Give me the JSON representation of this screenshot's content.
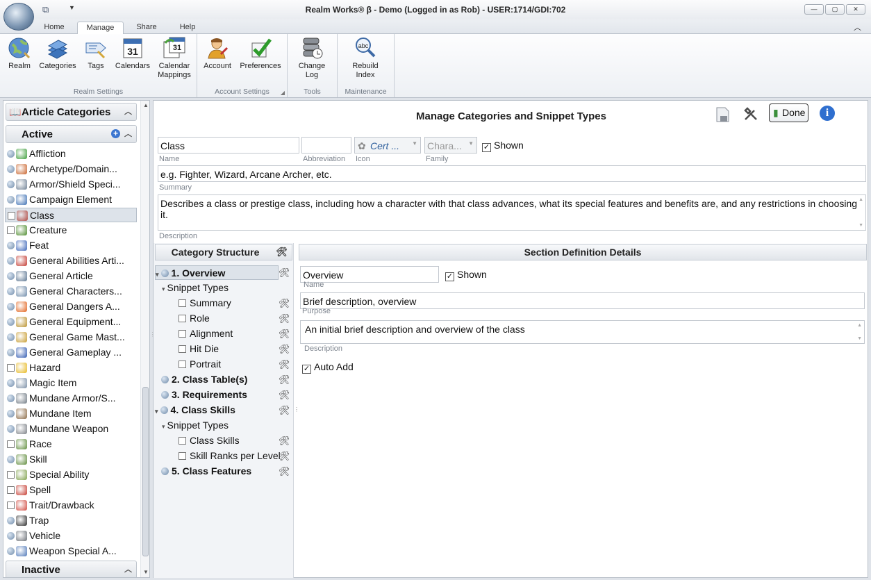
{
  "window": {
    "title": "Realm Works® β - Demo (Logged in as Rob) - USER:1714/GDI:702"
  },
  "tabs": [
    "Home",
    "Manage",
    "Share",
    "Help"
  ],
  "ribbon": {
    "realm_settings": {
      "label": "Realm Settings",
      "buttons": [
        "Realm",
        "Categories",
        "Tags",
        "Calendars",
        "Calendar Mappings"
      ]
    },
    "account_settings": {
      "label": "Account Settings",
      "buttons": [
        "Account",
        "Preferences"
      ]
    },
    "tools": {
      "label": "Tools",
      "buttons": [
        "Change Log"
      ]
    },
    "maintenance": {
      "label": "Maintenance",
      "buttons": [
        "Rebuild Index"
      ]
    }
  },
  "sidebar": {
    "title": "Article Categories",
    "active_label": "Active",
    "inactive_label": "Inactive",
    "items": [
      {
        "label": "Affliction",
        "status": "globe",
        "color": "#3a9b37"
      },
      {
        "label": "Archetype/Domain...",
        "status": "globe",
        "color": "#c8622a"
      },
      {
        "label": "Armor/Shield Speci...",
        "status": "globe",
        "color": "#6d7f93"
      },
      {
        "label": "Campaign Element",
        "status": "globe",
        "color": "#3c6fb3"
      },
      {
        "label": "Class",
        "status": "dice",
        "color": "#b0463f"
      },
      {
        "label": "Creature",
        "status": "dice",
        "color": "#4d8b2c"
      },
      {
        "label": "Feat",
        "status": "globe",
        "color": "#3a64b8"
      },
      {
        "label": "General Abilities Arti...",
        "status": "globe",
        "color": "#c2372e"
      },
      {
        "label": "General Article",
        "status": "globe",
        "color": "#5a7490"
      },
      {
        "label": "General Characters...",
        "status": "globe",
        "color": "#6d8aa9"
      },
      {
        "label": "General Dangers A...",
        "status": "globe",
        "color": "#e2631d"
      },
      {
        "label": "General Equipment...",
        "status": "globe",
        "color": "#b8902b"
      },
      {
        "label": "General Game Mast...",
        "status": "globe",
        "color": "#c79b2e"
      },
      {
        "label": "General Gameplay ...",
        "status": "globe",
        "color": "#2f59b0"
      },
      {
        "label": "Hazard",
        "status": "dice",
        "color": "#e6b820"
      },
      {
        "label": "Magic Item",
        "status": "globe",
        "color": "#7a8ea5"
      },
      {
        "label": "Mundane Armor/S...",
        "status": "globe",
        "color": "#707a84"
      },
      {
        "label": "Mundane Item",
        "status": "globe",
        "color": "#8b6a45"
      },
      {
        "label": "Mundane Weapon",
        "status": "globe",
        "color": "#7b7f85"
      },
      {
        "label": "Race",
        "status": "dice",
        "color": "#5e8c3a"
      },
      {
        "label": "Skill",
        "status": "globe",
        "color": "#5f8b3b"
      },
      {
        "label": "Special Ability",
        "status": "dice",
        "color": "#7ea04a"
      },
      {
        "label": "Spell",
        "status": "dice",
        "color": "#c53a2f"
      },
      {
        "label": "Trait/Drawback",
        "status": "dice",
        "color": "#d0473d"
      },
      {
        "label": "Trap",
        "status": "globe",
        "color": "#2b2b2b"
      },
      {
        "label": "Vehicle",
        "status": "globe",
        "color": "#6a6f76"
      },
      {
        "label": "Weapon Special A...",
        "status": "globe",
        "color": "#4f78b8"
      }
    ]
  },
  "main": {
    "title": "Manage Categories and Snippet Types",
    "done_label": "Done",
    "name_value": "Class",
    "name_label": "Name",
    "abbreviation_value": "",
    "abbreviation_label": "Abbreviation",
    "icon_value": "Cert ...",
    "icon_label": "Icon",
    "family_value": "Chara...",
    "family_label": "Family",
    "shown_label": "Shown",
    "summary_value": "e.g. Fighter, Wizard, Arcane Archer, etc.",
    "summary_label": "Summary",
    "description_value": "Describes a class or prestige class, including how a character with that class advances, what its special features and benefits are, and any restrictions in choosing it.",
    "description_label": "Description"
  },
  "structure": {
    "title": "Category Structure",
    "rows": [
      {
        "label": "1. Overview",
        "kind": "section"
      },
      {
        "label": "Snippet Types",
        "kind": "group"
      },
      {
        "label": "Summary",
        "kind": "snippet"
      },
      {
        "label": "Role",
        "kind": "snippet"
      },
      {
        "label": "Alignment",
        "kind": "snippet"
      },
      {
        "label": "Hit Die",
        "kind": "snippet"
      },
      {
        "label": "Portrait",
        "kind": "snippet"
      },
      {
        "label": "2. Class Table(s)",
        "kind": "section"
      },
      {
        "label": "3. Requirements",
        "kind": "section"
      },
      {
        "label": "4. Class Skills",
        "kind": "section"
      },
      {
        "label": "Snippet Types",
        "kind": "group"
      },
      {
        "label": "Class Skills",
        "kind": "snippet"
      },
      {
        "label": "Skill Ranks per Level",
        "kind": "snippet"
      },
      {
        "label": "5. Class Features",
        "kind": "section"
      }
    ]
  },
  "section": {
    "title": "Section Definition Details",
    "name_value": "Overview",
    "name_label": "Name",
    "shown_label": "Shown",
    "purpose_value": "Brief description, overview",
    "purpose_label": "Purpose",
    "description_value": "An initial brief description and overview of the class",
    "description_label": "Description",
    "auto_add_label": "Auto Add"
  }
}
